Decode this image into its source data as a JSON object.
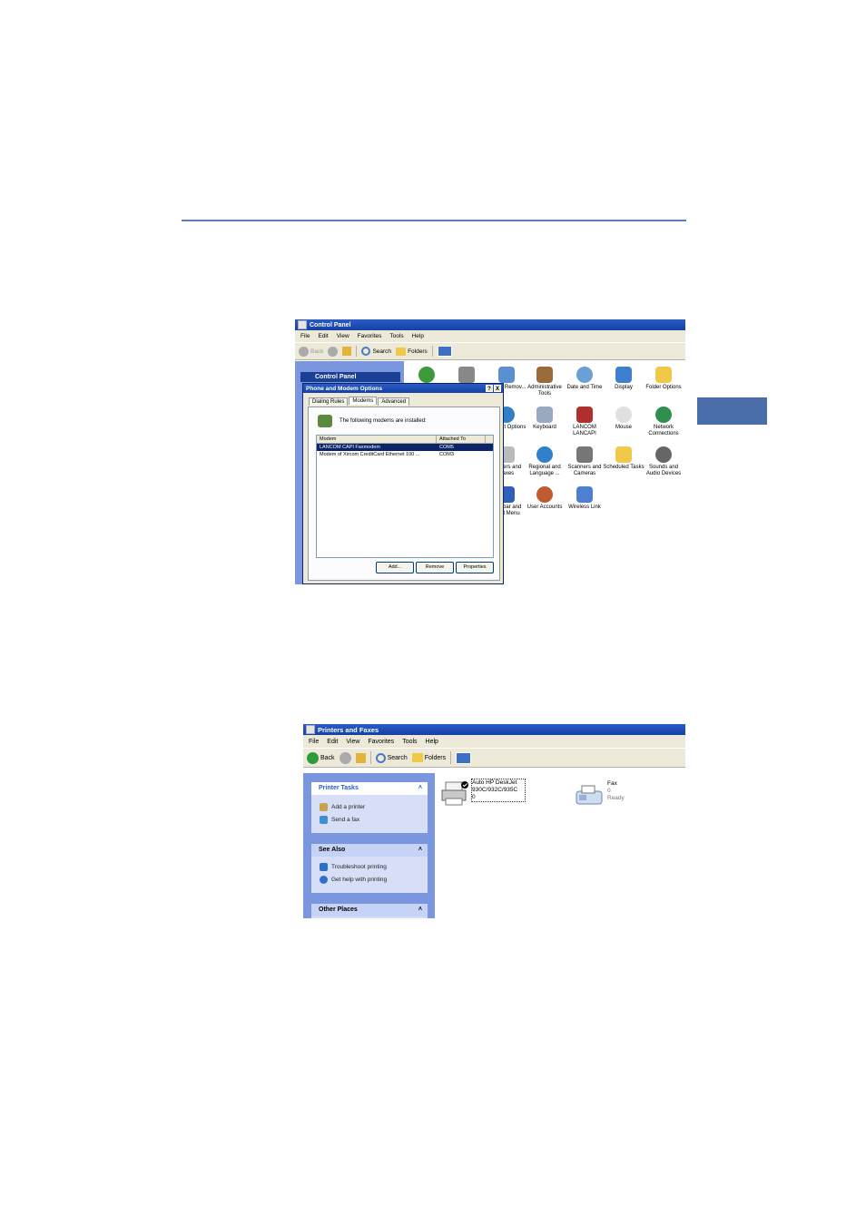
{
  "control_panel": {
    "title": "Control Panel",
    "menu": [
      "File",
      "Edit",
      "View",
      "Favorites",
      "Tools",
      "Help"
    ],
    "toolbar": {
      "back": "Back",
      "search": "Search",
      "folders": "Folders"
    },
    "task_header": "Control Panel",
    "icons": [
      {
        "label": "Add or Remov..."
      },
      {
        "label": "Administrative Tools"
      },
      {
        "label": "Date and Time"
      },
      {
        "label": "Display"
      },
      {
        "label": "Folder Options"
      },
      {
        "label": "Internet Options"
      },
      {
        "label": "Keyboard"
      },
      {
        "label": "LANCOM LANCAPI"
      },
      {
        "label": "Mouse"
      },
      {
        "label": "Network Connections"
      },
      {
        "label": "Printers and Faxes"
      },
      {
        "label": "Regional and Language ..."
      },
      {
        "label": "Scanners and Cameras"
      },
      {
        "label": "Scheduled Tasks"
      },
      {
        "label": "Sounds and Audio Devices"
      },
      {
        "label": "Taskbar and Start Menu"
      },
      {
        "label": "User Accounts"
      },
      {
        "label": "Wireless Link"
      }
    ]
  },
  "dialog": {
    "title": "Phone and Modem Options",
    "help_button": "?",
    "close_button": "X",
    "tabs": [
      "Dialing Rules",
      "Modems",
      "Advanced"
    ],
    "message": "The following modems are installed:",
    "columns": [
      "Modem",
      "Attached To"
    ],
    "rows": [
      {
        "modem": "LANCOM CAPI Faxmodem",
        "port": "COM5"
      },
      {
        "modem": "Modem of Xircom CreditCard Ethernet 100 ...",
        "port": "COM3"
      }
    ],
    "buttons": {
      "add": "Add...",
      "remove": "Remove",
      "properties": "Properties"
    }
  },
  "printers": {
    "title": "Printers and Faxes",
    "menu": [
      "File",
      "Edit",
      "View",
      "Favorites",
      "Tools",
      "Help"
    ],
    "toolbar": {
      "back": "Back",
      "search": "Search",
      "folders": "Folders"
    },
    "printer_tasks": {
      "title": "Printer Tasks",
      "items": [
        "Add a printer",
        "Send a fax"
      ]
    },
    "see_also": {
      "title": "See Also",
      "items": [
        "Troubleshoot printing",
        "Get help with printing"
      ]
    },
    "other_places": {
      "title": "Other Places"
    },
    "printer": {
      "name": "Auto HP DeskJet 930C/932C/935C",
      "count": "0"
    },
    "fax": {
      "name": "Fax",
      "count": "0",
      "status": "Ready"
    }
  }
}
